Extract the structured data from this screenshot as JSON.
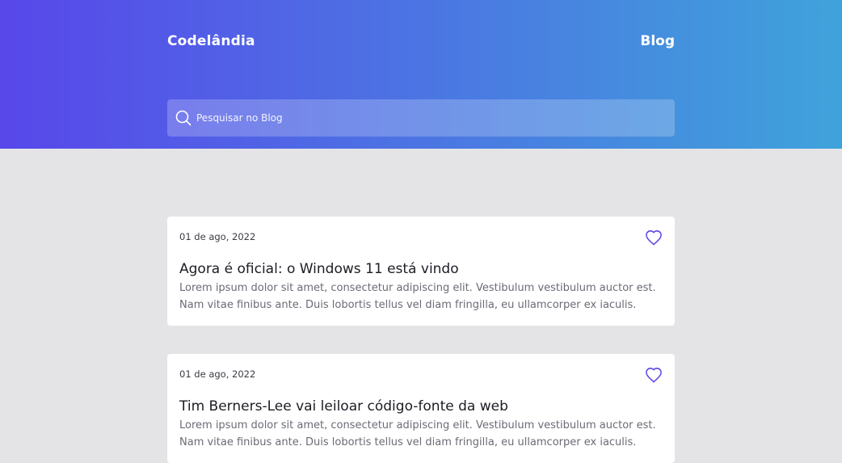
{
  "header": {
    "brand": "Codelândia",
    "nav_blog": "Blog",
    "search": {
      "placeholder": "Pesquisar no Blog",
      "value": ""
    }
  },
  "posts": [
    {
      "date": "01 de ago, 2022",
      "title": "Agora é oficial: o Windows 11 está vindo",
      "text": "Lorem ipsum dolor sit amet, consectetur adipiscing elit. Vestibulum vestibulum auctor est. Nam vitae finibus ante. Duis lobortis tellus vel diam fringilla, eu ullamcorper ex iaculis.",
      "favorite_icon": "heart-outline-icon"
    },
    {
      "date": "01 de ago, 2022",
      "title": "Tim Berners-Lee vai leiloar código-fonte da web",
      "text": "Lorem ipsum dolor sit amet, consectetur adipiscing elit. Vestibulum vestibulum auctor est. Nam vitae finibus ante. Duis lobortis tellus vel diam fringilla, eu ullamcorper ex iaculis.",
      "favorite_icon": "heart-outline-icon"
    }
  ],
  "colors": {
    "gradient_start": "#5847ea",
    "gradient_end": "#3fa3db",
    "page_bg": "#e4e4e6",
    "heart": "#5b4ae6"
  }
}
